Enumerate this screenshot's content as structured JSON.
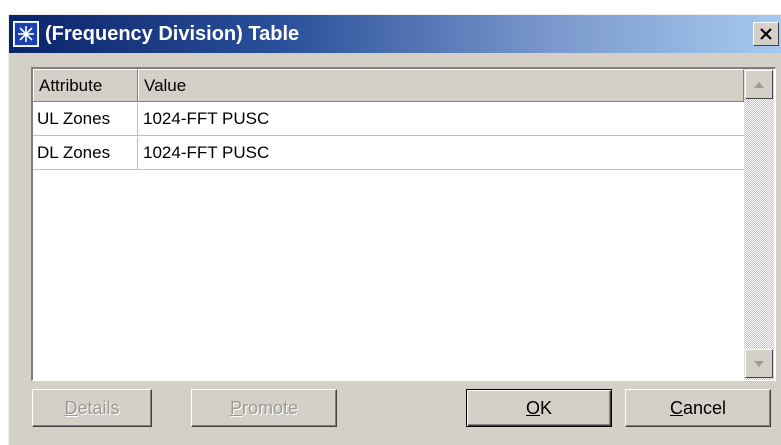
{
  "window": {
    "title": "(Frequency Division) Table",
    "close_glyph": "×"
  },
  "table": {
    "columns": [
      "Attribute",
      "Value"
    ],
    "rows": [
      {
        "attribute": "UL Zones",
        "value": "1024-FFT PUSC"
      },
      {
        "attribute": "DL Zones",
        "value": "1024-FFT PUSC"
      }
    ]
  },
  "buttons": {
    "details": {
      "mnemonic": "D",
      "rest": "etails",
      "enabled": false
    },
    "promote": {
      "mnemonic": "P",
      "rest": "romote",
      "enabled": false
    },
    "ok": {
      "mnemonic": "O",
      "rest": "K",
      "enabled": true
    },
    "cancel": {
      "mnemonic": "C",
      "rest": "ancel",
      "enabled": true
    }
  },
  "colors": {
    "title_start": "#0a246a",
    "title_end": "#a6caf0",
    "face": "#d4d0c8"
  },
  "icons": {
    "app": "starburst-icon",
    "close": "close-icon",
    "scroll_up": "arrow-up-icon",
    "scroll_down": "arrow-down-icon"
  }
}
